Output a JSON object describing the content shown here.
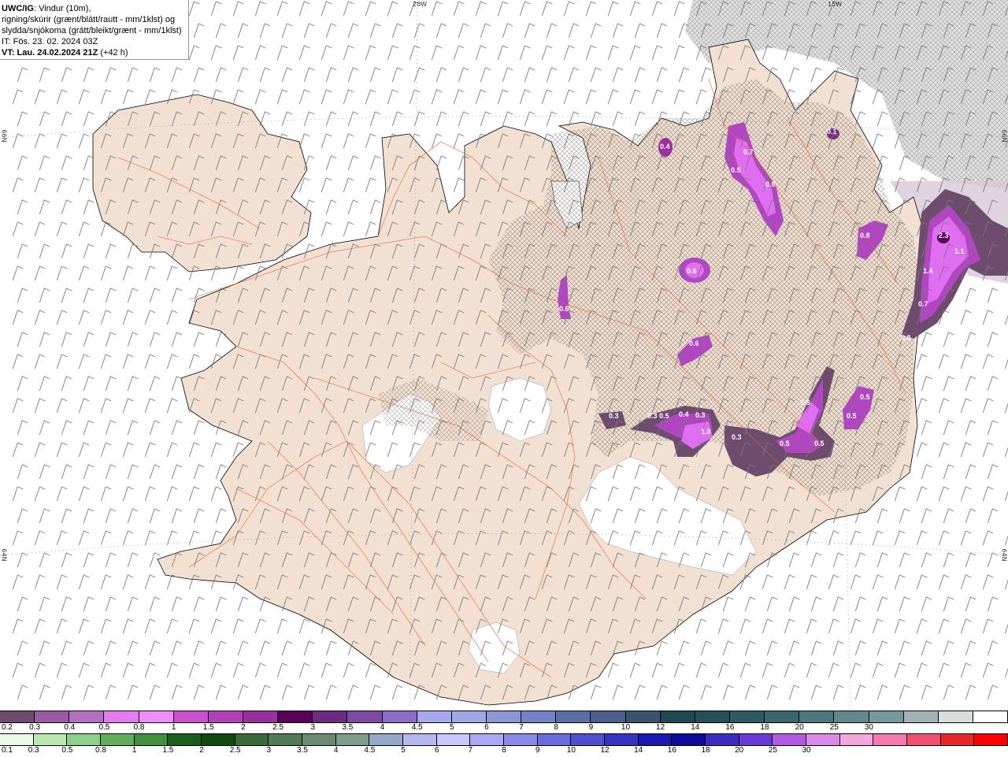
{
  "header": {
    "line1_bold": "UWC/IG",
    "line1_rest": ": Vindur (10m),",
    "line2": "rigning/skúrir (grænt/blátt/rautt - mm/1klst) og",
    "line3": "slydda/snjókoma (grátt/bleikt/grænt - mm/1klst)",
    "line4": "IT: Fös. 23. 02. 2024 03Z",
    "line5_bold": "VT: Lau. 24.02.2024 21Z",
    "line5_rest": " (+42 h)"
  },
  "edge_labels": {
    "top_20w": "20W",
    "top_15w": "15W",
    "left_66n": "66N",
    "right_66n": "66N",
    "left_64n": "64N",
    "right_64n": "64N"
  },
  "precip_labels": [
    "0.4",
    "0.7",
    "0.5",
    "0.8",
    "0.1",
    "0.8",
    "2.3",
    "1.1",
    "1.4",
    "0.7",
    "0.3",
    "0.6",
    "0.6",
    "0.6",
    "0.3",
    "0.3",
    "0.5",
    "0.4",
    "0.3",
    "1.0",
    "0.3",
    "0.5",
    "0.8",
    "0.5",
    "0.5",
    "0.5"
  ],
  "legend": {
    "snow_colors": [
      "#6e4c6e",
      "#9b59a6",
      "#b46ec3",
      "#e47cf0",
      "#f08cf8",
      "#c94fcf",
      "#b33fbb",
      "#9b2f9f",
      "#5a005a",
      "#6b2d83",
      "#7d4aa6",
      "#8c6cc4",
      "#a8a8f0",
      "#9ea8e6",
      "#8a96d6",
      "#7382c6",
      "#5c6ea8",
      "#4c5f8c",
      "#3a5470",
      "#1d4a52",
      "#244e5a",
      "#2e5a66",
      "#3a6670",
      "#4d767e",
      "#60888e",
      "#77999e",
      "#a2b3b6",
      "#d9dddd",
      "#ffffff"
    ],
    "snow_labels": [
      "0.2",
      "0.3",
      "0.4",
      "0.5",
      "0.8",
      "1",
      "1.5",
      "2",
      "2.5",
      "3",
      "3.5",
      "4",
      "4.5",
      "5",
      "6",
      "7",
      "8",
      "9",
      "10",
      "12",
      "14",
      "16",
      "18",
      "20",
      "25",
      "30"
    ],
    "rain_colors": [
      "#e8fbe8",
      "#b8e8b0",
      "#8ccf88",
      "#5fae5a",
      "#3f8f3c",
      "#1b5e1b",
      "#0e4a0e",
      "#3a6a3a",
      "#527a5a",
      "#6a8a72",
      "#7e9e8a",
      "#94a8c8",
      "#b4b8f0",
      "#c8c8fc",
      "#a9a9f4",
      "#8a8ae8",
      "#6c6cdc",
      "#5050cf",
      "#3434c0",
      "#1a1ab0",
      "#0a0a9a",
      "#3b2bc0",
      "#6a3ad6",
      "#b05ae0",
      "#d98ae8",
      "#f2a8dc",
      "#f57ab0",
      "#f05070",
      "#e82828",
      "#ff0000"
    ],
    "rain_labels": [
      "0.1",
      "0.3",
      "0.5",
      "0.8",
      "1",
      "1.5",
      "2",
      "2.5",
      "3",
      "3.5",
      "4",
      "4.5",
      "5",
      "6",
      "7",
      "8",
      "9",
      "10",
      "12",
      "14",
      "16",
      "18",
      "20",
      "25",
      "30"
    ]
  }
}
